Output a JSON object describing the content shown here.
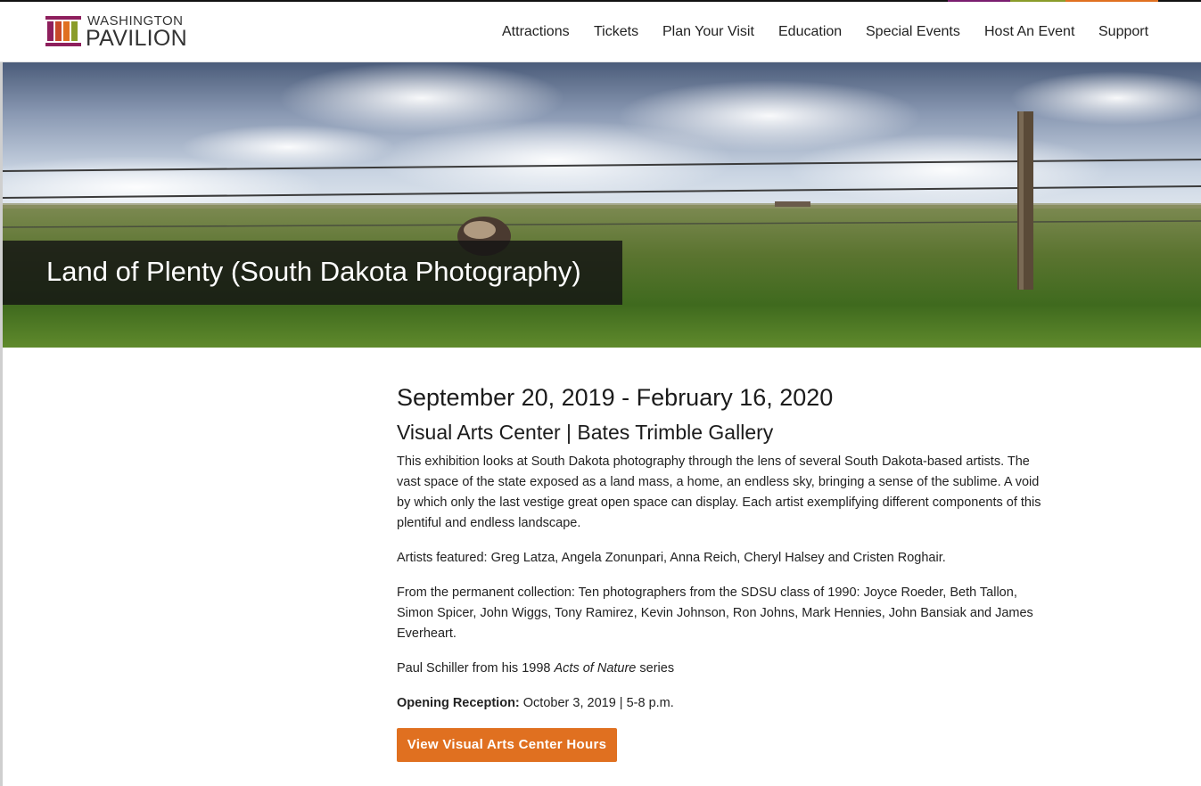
{
  "brand": {
    "line1": "WASHINGTON",
    "line2": "PAVILION",
    "stripe_colors": [
      "#7a1d6f",
      "#8a9c2a",
      "#e07020"
    ],
    "mark_colors": [
      "#8e1f5d",
      "#c8492a",
      "#e07020",
      "#8a9c2a"
    ]
  },
  "nav": {
    "items": [
      "Attractions",
      "Tickets",
      "Plan Your Visit",
      "Education",
      "Special Events",
      "Host An Event",
      "Support"
    ]
  },
  "hero": {
    "title": "Land of Plenty (South Dakota Photography)"
  },
  "exhibit": {
    "dates": "September 20, 2019 - February 16, 2020",
    "venue": "Visual Arts Center | Bates Trimble Gallery",
    "description": "This exhibition looks at South Dakota photography through the lens of several South Dakota-based artists. The vast space of the state exposed as a land mass, a home, an endless sky, bringing a sense of the sublime. A void by which only the last vestige great open space can display. Each artist exemplifying different components of this plentiful and endless landscape.",
    "artists": "Artists featured: Greg Latza, Angela Zonunpari, Anna Reich, Cheryl Halsey and Cristen Roghair.",
    "collection": "From the permanent collection: Ten photographers from the SDSU class of 1990: Joyce Roeder, Beth Tallon, Simon Spicer, John Wiggs, Tony Ramirez, Kevin Johnson, Ron Johns, Mark Hennies, John Bansiak and James Everheart.",
    "schiller_prefix": "Paul Schiller from his 1998 ",
    "schiller_series": "Acts of Nature",
    "schiller_suffix": " series",
    "reception_label": "Opening Reception:",
    "reception_value": " October 3, 2019 | 5-8 p.m.",
    "button_label": "View Visual Arts Center Hours",
    "accent": "#e07020"
  }
}
